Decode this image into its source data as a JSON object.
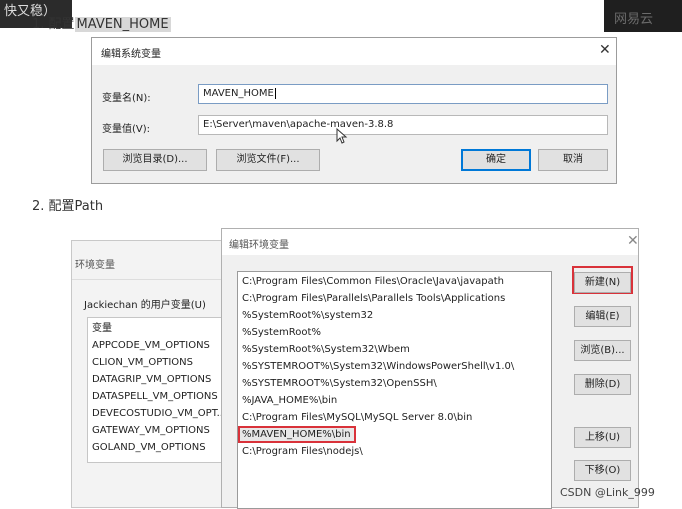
{
  "top_fragment": "快又稳）",
  "step1": {
    "prefix": "1. 配置",
    "highlight": "MAVEN_HOME"
  },
  "watermark": "网易云",
  "system_var_dialog": {
    "title": "编辑系统变量",
    "close_glyph": "✕",
    "name_label": "变量名(N):",
    "name_value": "MAVEN_HOME",
    "value_label": "变量值(V):",
    "value_value": "E:\\Server\\maven\\apache-maven-3.8.8",
    "browse_dir_label": "浏览目录(D)...",
    "browse_file_label": "浏览文件(F)...",
    "ok_label": "确定",
    "cancel_label": "取消"
  },
  "step2": "2. 配置Path",
  "env_dialog_bg": {
    "title": "环境变量",
    "user_vars_label": "Jackiechan 的用户变量(U)",
    "column_header": "变量",
    "items": [
      "APPCODE_VM_OPTIONS",
      "CLION_VM_OPTIONS",
      "DATAGRIP_VM_OPTIONS",
      "DATASPELL_VM_OPTIONS",
      "DEVECOSTUDIO_VM_OPT...",
      "GATEWAY_VM_OPTIONS",
      "GOLAND_VM_OPTIONS"
    ]
  },
  "path_dialog": {
    "title": "编辑环境变量",
    "close_glyph": "✕",
    "entries": [
      "C:\\Program Files\\Common Files\\Oracle\\Java\\javapath",
      "C:\\Program Files\\Parallels\\Parallels Tools\\Applications",
      "%SystemRoot%\\system32",
      "%SystemRoot%",
      "%SystemRoot%\\System32\\Wbem",
      "%SYSTEMROOT%\\System32\\WindowsPowerShell\\v1.0\\",
      "%SYSTEMROOT%\\System32\\OpenSSH\\",
      "%JAVA_HOME%\\bin",
      "C:\\Program Files\\MySQL\\MySQL Server 8.0\\bin",
      "%MAVEN_HOME%\\bin",
      "C:\\Program Files\\nodejs\\"
    ],
    "selected_index": 9,
    "buttons": {
      "new": "新建(N)",
      "edit": "编辑(E)",
      "browse": "浏览(B)...",
      "delete": "删除(D)",
      "up": "上移(U)",
      "down": "下移(O)"
    }
  },
  "credit": "CSDN @Link_999",
  "colors": {
    "highlight_red": "#d9323a",
    "focus_blue": "#0078d7"
  }
}
